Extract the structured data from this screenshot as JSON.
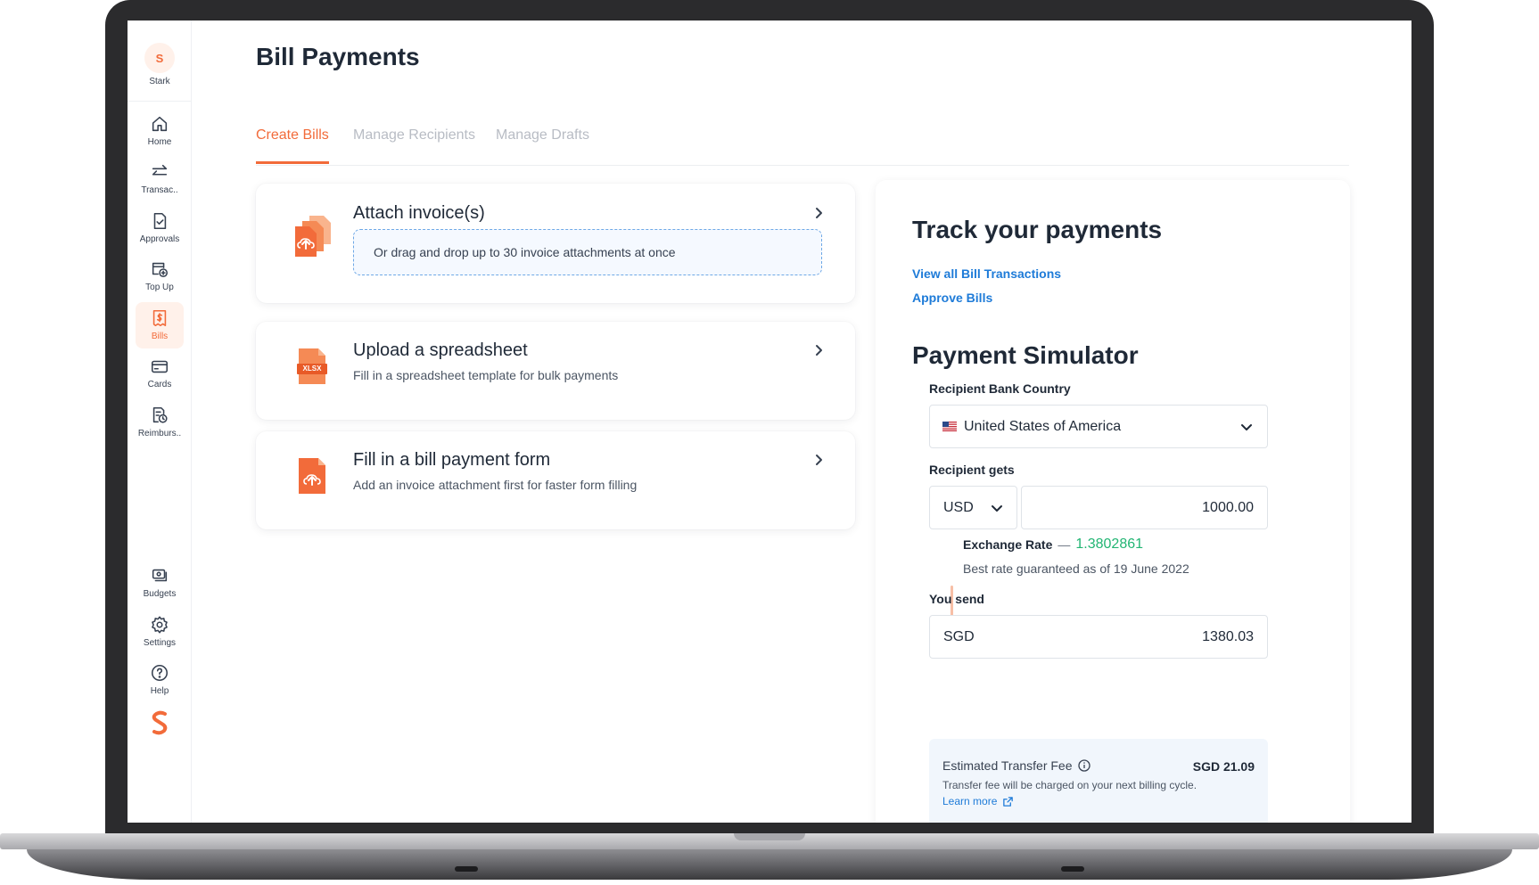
{
  "sidebar": {
    "user": {
      "initial": "S",
      "name": "Stark"
    },
    "items": [
      {
        "label": "Home",
        "icon": "home-icon"
      },
      {
        "label": "Transac..",
        "icon": "transfer-icon"
      },
      {
        "label": "Approvals",
        "icon": "approvals-icon"
      },
      {
        "label": "Top Up",
        "icon": "top-up-icon"
      },
      {
        "label": "Bills",
        "icon": "bills-icon",
        "active": true
      },
      {
        "label": "Cards",
        "icon": "card-icon"
      },
      {
        "label": "Reimburs..",
        "icon": "reimbursement-icon"
      }
    ],
    "bottom_items": [
      {
        "label": "Budgets",
        "icon": "budgets-icon"
      },
      {
        "label": "Settings",
        "icon": "gear-icon"
      },
      {
        "label": "Help",
        "icon": "help-icon"
      }
    ],
    "logo": "spenmo-logo"
  },
  "page": {
    "title": "Bill Payments"
  },
  "tabs": [
    {
      "label": "Create Bills",
      "active": true
    },
    {
      "label": "Manage Recipients",
      "active": false
    },
    {
      "label": "Manage Drafts",
      "active": false
    }
  ],
  "options": {
    "attach": {
      "title": "Attach invoice(s)",
      "dropzone": "Or drag and drop up to 30 invoice attachments at once"
    },
    "spreadsheet": {
      "title": "Upload a spreadsheet",
      "subtitle": "Fill in a spreadsheet template for bulk payments",
      "badge": "XLSX"
    },
    "form": {
      "title": "Fill in a bill payment form",
      "subtitle": "Add an invoice attachment first for faster form filling"
    }
  },
  "track": {
    "title": "Track your payments",
    "links": [
      "View all Bill Transactions",
      "Approve Bills"
    ]
  },
  "simulator": {
    "title": "Payment Simulator",
    "country_label": "Recipient Bank Country",
    "country_value": "United States of America",
    "recipient_label": "Recipient gets",
    "recipient_currency": "USD",
    "recipient_amount": "1000.00",
    "rate_label": "Exchange Rate",
    "rate_dash": "—",
    "rate_value": "1.3802861",
    "rate_note": "Best rate guaranteed as of 19 June 2022",
    "send_label": "You send",
    "send_currency": "SGD",
    "send_amount": "1380.03",
    "fee_label": "Estimated Transfer Fee",
    "fee_value": "SGD 21.09",
    "fee_note": "Transfer fee will be charged on your next billing cycle.",
    "learn_more": "Learn more"
  },
  "colors": {
    "accent": "#f26b3a",
    "link": "#1e7bd8",
    "rate": "#22b573"
  }
}
